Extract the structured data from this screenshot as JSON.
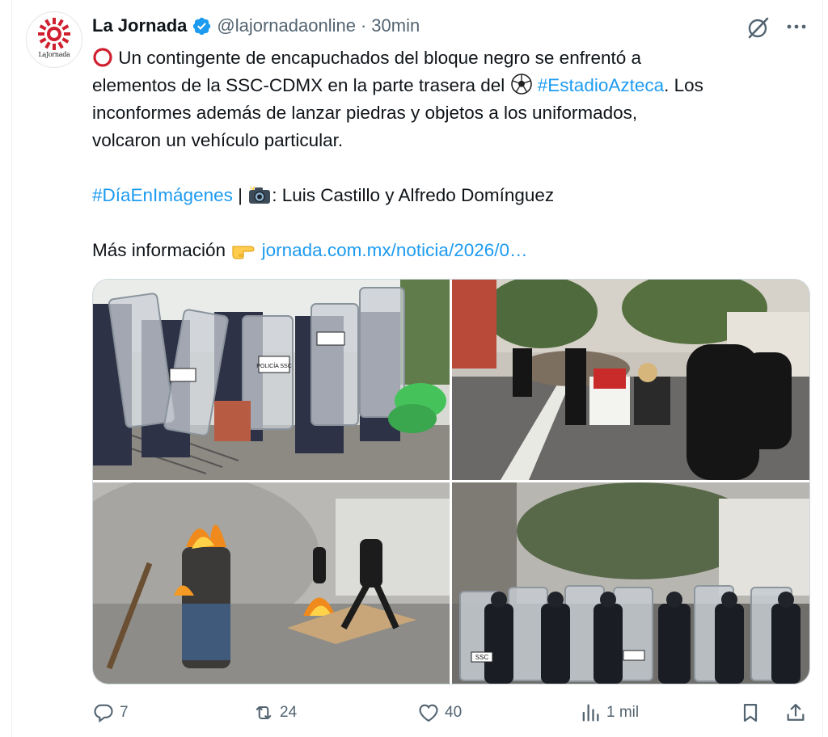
{
  "tweet": {
    "display_name": "La Jornada",
    "handle": "@lajornadaonline",
    "separator": "·",
    "time": "30min",
    "avatar_text": "LaJornada",
    "line1": "Un contingente de encapuchados del bloque negro se enfrentó a",
    "line2_a": "elementos de la SSC-CDMX en la parte trasera del",
    "line2_hashtag": "#EstadioAzteca",
    "line2_b": ". Los",
    "line3": "inconformes además de lanzar piedras y objetos a los uniformados,",
    "line4": "volcaron un vehículo particular.",
    "credits_hashtag": "#DíaEnImágenes",
    "credits_sep": " | ",
    "credits_text": ": Luis Castillo y Alfredo Domínguez",
    "more_info": "Más información",
    "link": "jornada.com.mx/noticia/2026/0…"
  },
  "media": {
    "photo1": {
      "shield_text": "POLICÍA SSC"
    },
    "photo2": {
      "shield_text": ""
    },
    "photo3": {
      "shield_text": ""
    },
    "photo4": {
      "shield_text": "SSC"
    }
  },
  "actions": {
    "replies": "7",
    "retweets": "24",
    "likes": "40",
    "views": "1 mil"
  },
  "icons": {
    "avatar": "la-jornada-logo",
    "verified": "verified-badge-icon",
    "grok": "grok-icon",
    "more": "more-icon",
    "reply": "reply-icon",
    "retweet": "retweet-icon",
    "like": "heart-icon",
    "views": "views-icon",
    "bookmark": "bookmark-icon",
    "share": "share-icon"
  },
  "colors": {
    "text": "#0f1419",
    "muted": "#536471",
    "link": "#1d9bf0",
    "logo_red": "#d0202f"
  }
}
